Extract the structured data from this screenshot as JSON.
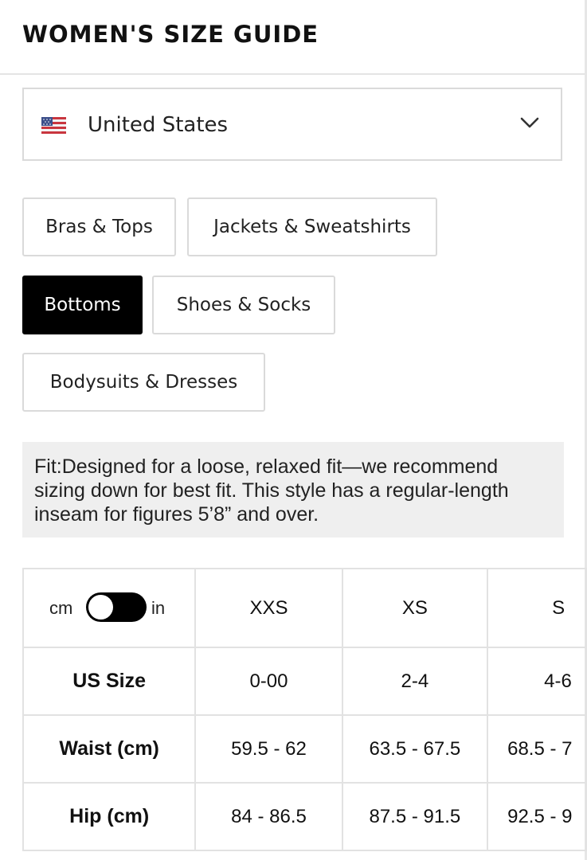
{
  "header": {
    "title": "WOMEN'S SIZE GUIDE"
  },
  "country_select": {
    "flag_icon": "us-flag-icon",
    "selected": "United States",
    "chevron_icon": "chevron-down-icon"
  },
  "category_tabs": [
    {
      "label": "Bras & Tops",
      "active": false
    },
    {
      "label": "Jackets & Sweatshirts",
      "active": false
    },
    {
      "label": "Bottoms",
      "active": true
    },
    {
      "label": "Shoes & Socks",
      "active": false
    },
    {
      "label": "Bodysuits & Dresses",
      "active": false
    }
  ],
  "fit_note": "Fit:Designed for a loose, relaxed fit—we recommend sizing down for best fit. This style has a regular-length inseam for figures 5’8” and over.",
  "unit_toggle": {
    "left_label": "cm",
    "right_label": "in",
    "selected": "cm"
  },
  "size_table": {
    "columns": [
      "XXS",
      "XS",
      "S"
    ],
    "rows": [
      {
        "label": "US Size",
        "values": [
          "0-00",
          "2-4",
          "4-6"
        ]
      },
      {
        "label": "Waist (cm)",
        "values": [
          "59.5 - 62",
          "63.5 - 67.5",
          "68.5 - 7"
        ]
      },
      {
        "label": "Hip (cm)",
        "values": [
          "84 - 86.5",
          "87.5 - 91.5",
          "92.5 - 9"
        ]
      }
    ]
  },
  "colors": {
    "active_tab_bg": "#000000",
    "note_bg": "#efefef",
    "border": "#dadada"
  }
}
